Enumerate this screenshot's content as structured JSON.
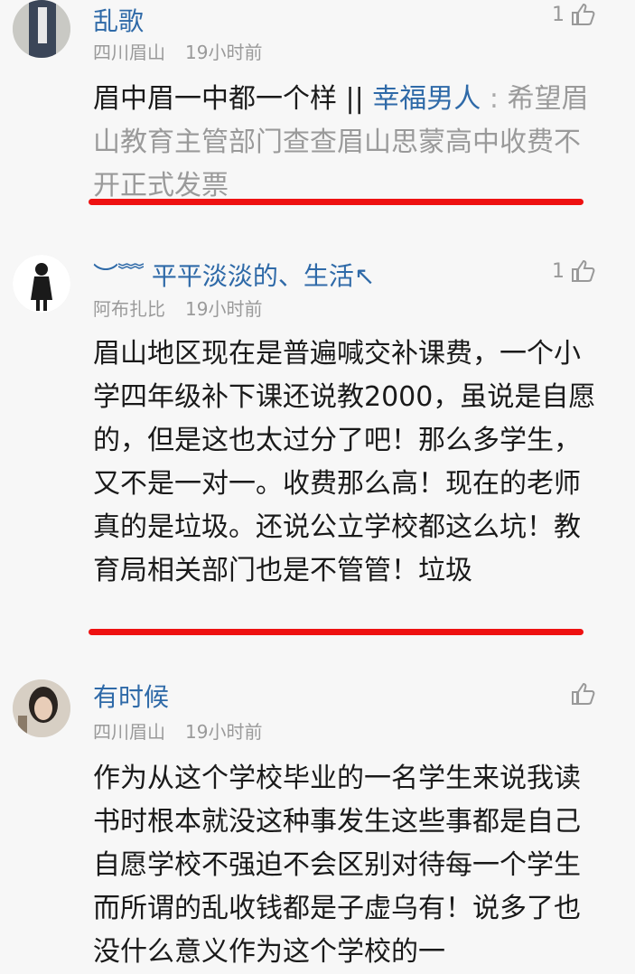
{
  "comments": [
    {
      "username": "乱歌",
      "location": "四川眉山",
      "time": "19小时前",
      "likes": "1",
      "text": "眉中眉一中都一个样 || ",
      "reply": {
        "name": "幸福男人",
        "sep": " : ",
        "text": "希望眉山教育主管部门查查眉山思蒙高中收费不开正式发票"
      }
    },
    {
      "username": "︶﹌ 平平淡淡的、生活↖",
      "location": "阿布扎比",
      "time": "19小时前",
      "likes": "1",
      "text": "眉山地区现在是普遍喊交补课费，一个小学四年级补下课还说教2000，虽说是自愿的，但是这也太过分了吧！那么多学生，又不是一对一。收费那么高！现在的老师真的是垃圾。还说公立学校都这么坑！教育局相关部门也是不管管！垃圾"
    },
    {
      "username": "有时候",
      "location": "四川眉山",
      "time": "19小时前",
      "likes": "",
      "text": "作为从这个学校毕业的一名学生来说我读书时根本就没这种事发生这些事都是自己自愿学校不强迫不会区别对待每一个学生而所谓的乱收钱都是子虚乌有！说多了也没什么意义作为这个学校的一"
    }
  ],
  "colors": {
    "username": "#2f6aa8",
    "underline": "#ee1111",
    "meta": "#9a9a9a"
  },
  "icons": {
    "like": "thumbs-up-icon"
  }
}
